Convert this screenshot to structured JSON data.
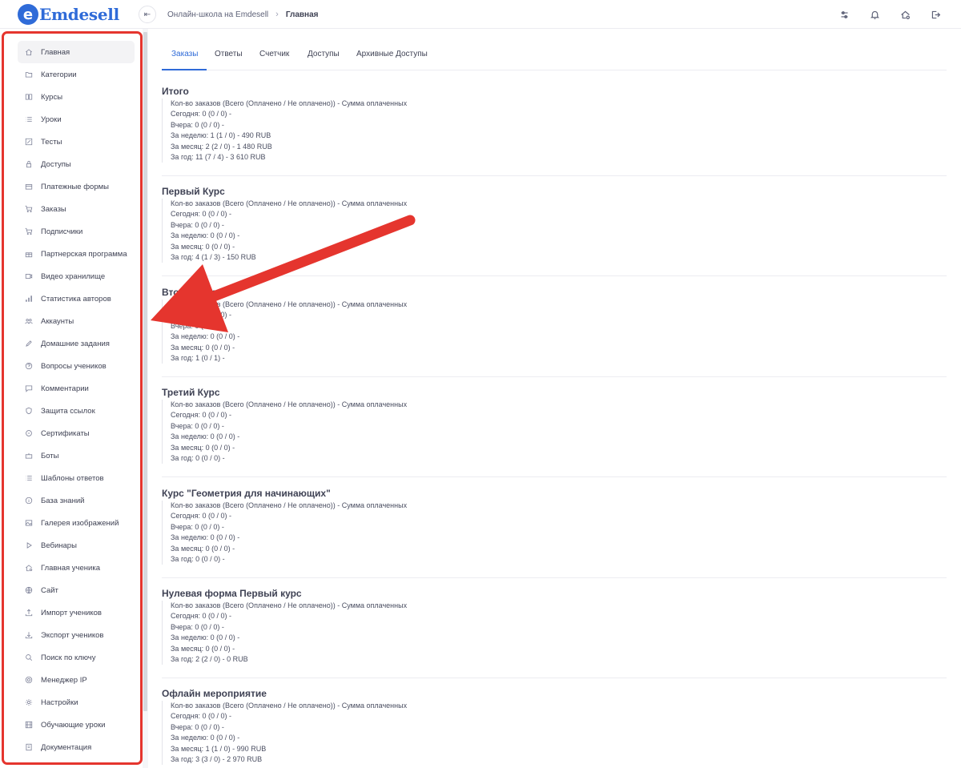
{
  "app": {
    "logo_letter": "e",
    "logo_text": "Emdesell",
    "brand_color": "#2f6bd8"
  },
  "breadcrumb": {
    "parent": "Онлайн-школа на Emdesell",
    "current": "Главная"
  },
  "header_icons": [
    "sliders-icon",
    "bell-icon",
    "home-settings-icon",
    "logout-icon"
  ],
  "sidebar": {
    "items": [
      {
        "label": "Главная",
        "icon": "home-icon",
        "active": true
      },
      {
        "label": "Категории",
        "icon": "folder-icon"
      },
      {
        "label": "Курсы",
        "icon": "book-icon"
      },
      {
        "label": "Уроки",
        "icon": "list-icon"
      },
      {
        "label": "Тесты",
        "icon": "edit-icon"
      },
      {
        "label": "Доступы",
        "icon": "lock-icon"
      },
      {
        "label": "Платежные формы",
        "icon": "credit-card-icon"
      },
      {
        "label": "Заказы",
        "icon": "cart-icon"
      },
      {
        "label": "Подписчики",
        "icon": "cart-icon"
      },
      {
        "label": "Партнерская программа",
        "icon": "gift-icon"
      },
      {
        "label": "Видео хранилище",
        "icon": "video-icon"
      },
      {
        "label": "Статистика авторов",
        "icon": "bar-chart-icon"
      },
      {
        "label": "Аккаунты",
        "icon": "users-icon"
      },
      {
        "label": "Домашние задания",
        "icon": "pencil-icon"
      },
      {
        "label": "Вопросы учеников",
        "icon": "help-circle-icon"
      },
      {
        "label": "Комментарии",
        "icon": "comment-icon"
      },
      {
        "label": "Защита ссылок",
        "icon": "shield-icon"
      },
      {
        "label": "Сертификаты",
        "icon": "certificate-icon"
      },
      {
        "label": "Боты",
        "icon": "bot-icon"
      },
      {
        "label": "Шаблоны ответов",
        "icon": "list-icon"
      },
      {
        "label": "База знаний",
        "icon": "info-icon"
      },
      {
        "label": "Галерея изображений",
        "icon": "image-icon"
      },
      {
        "label": "Вебинары",
        "icon": "play-icon"
      },
      {
        "label": "Главная ученика",
        "icon": "home-user-icon"
      },
      {
        "label": "Сайт",
        "icon": "globe-icon"
      },
      {
        "label": "Импорт учеников",
        "icon": "upload-icon"
      },
      {
        "label": "Экспорт учеников",
        "icon": "download-icon"
      },
      {
        "label": "Поиск по ключу",
        "icon": "search-icon"
      },
      {
        "label": "Менеджер IP",
        "icon": "network-icon"
      },
      {
        "label": "Настройки",
        "icon": "gear-icon"
      },
      {
        "label": "Обучающие уроки",
        "icon": "film-icon"
      },
      {
        "label": "Документация",
        "icon": "document-icon"
      }
    ]
  },
  "tabs": [
    {
      "label": "Заказы",
      "active": true
    },
    {
      "label": "Ответы"
    },
    {
      "label": "Счетчик"
    },
    {
      "label": "Доступы"
    },
    {
      "label": "Архивные Доступы"
    }
  ],
  "sections": [
    {
      "title": "Итого",
      "lines": [
        "Кол-во заказов (Всего (Оплачено / Не оплачено)) - Сумма оплаченных",
        "Сегодня: 0 (0 / 0) -",
        "Вчера: 0 (0 / 0) -",
        "За неделю: 1 (1 / 0) - 490 RUB",
        "За месяц: 2 (2 / 0) - 1 480 RUB",
        "За год: 11 (7 / 4) - 3 610 RUB"
      ]
    },
    {
      "title": "Первый Курс",
      "lines": [
        "Кол-во заказов (Всего (Оплачено / Не оплачено)) - Сумма оплаченных",
        "Сегодня: 0 (0 / 0) -",
        "Вчера: 0 (0 / 0) -",
        "За неделю: 0 (0 / 0) -",
        "За месяц: 0 (0 / 0) -",
        "За год: 4 (1 / 3) - 150 RUB"
      ]
    },
    {
      "title": "Второй Курс",
      "lines": [
        "Кол-во заказов (Всего (Оплачено / Не оплачено)) - Сумма оплаченных",
        "Сегодня: 0 (0 / 0) -",
        "Вчера: 0 (0 / 0) -",
        "За неделю: 0 (0 / 0) -",
        "За месяц: 0 (0 / 0) -",
        "За год: 1 (0 / 1) -"
      ]
    },
    {
      "title": "Третий Курс",
      "lines": [
        "Кол-во заказов (Всего (Оплачено / Не оплачено)) - Сумма оплаченных",
        "Сегодня: 0 (0 / 0) -",
        "Вчера: 0 (0 / 0) -",
        "За неделю: 0 (0 / 0) -",
        "За месяц: 0 (0 / 0) -",
        "За год: 0 (0 / 0) -"
      ]
    },
    {
      "title": "Курс \"Геометрия для начинающих\"",
      "lines": [
        "Кол-во заказов (Всего (Оплачено / Не оплачено)) - Сумма оплаченных",
        "Сегодня: 0 (0 / 0) -",
        "Вчера: 0 (0 / 0) -",
        "За неделю: 0 (0 / 0) -",
        "За месяц: 0 (0 / 0) -",
        "За год: 0 (0 / 0) -"
      ]
    },
    {
      "title": "Нулевая форма Первый курс",
      "lines": [
        "Кол-во заказов (Всего (Оплачено / Не оплачено)) - Сумма оплаченных",
        "Сегодня: 0 (0 / 0) -",
        "Вчера: 0 (0 / 0) -",
        "За неделю: 0 (0 / 0) -",
        "За месяц: 0 (0 / 0) -",
        "За год: 2 (2 / 0) - 0 RUB"
      ]
    },
    {
      "title": "Офлайн мероприятие",
      "lines": [
        "Кол-во заказов (Всего (Оплачено / Не оплачено)) - Сумма оплаченных",
        "Сегодня: 0 (0 / 0) -",
        "Вчера: 0 (0 / 0) -",
        "За неделю: 0 (0 / 0) -",
        "За месяц: 1 (1 / 0) - 990 RUB",
        "За год: 3 (3 / 0) - 2 970 RUB"
      ]
    }
  ],
  "annotation": {
    "arrow_color": "#e5352e",
    "highlight_color": "#e5352e"
  }
}
